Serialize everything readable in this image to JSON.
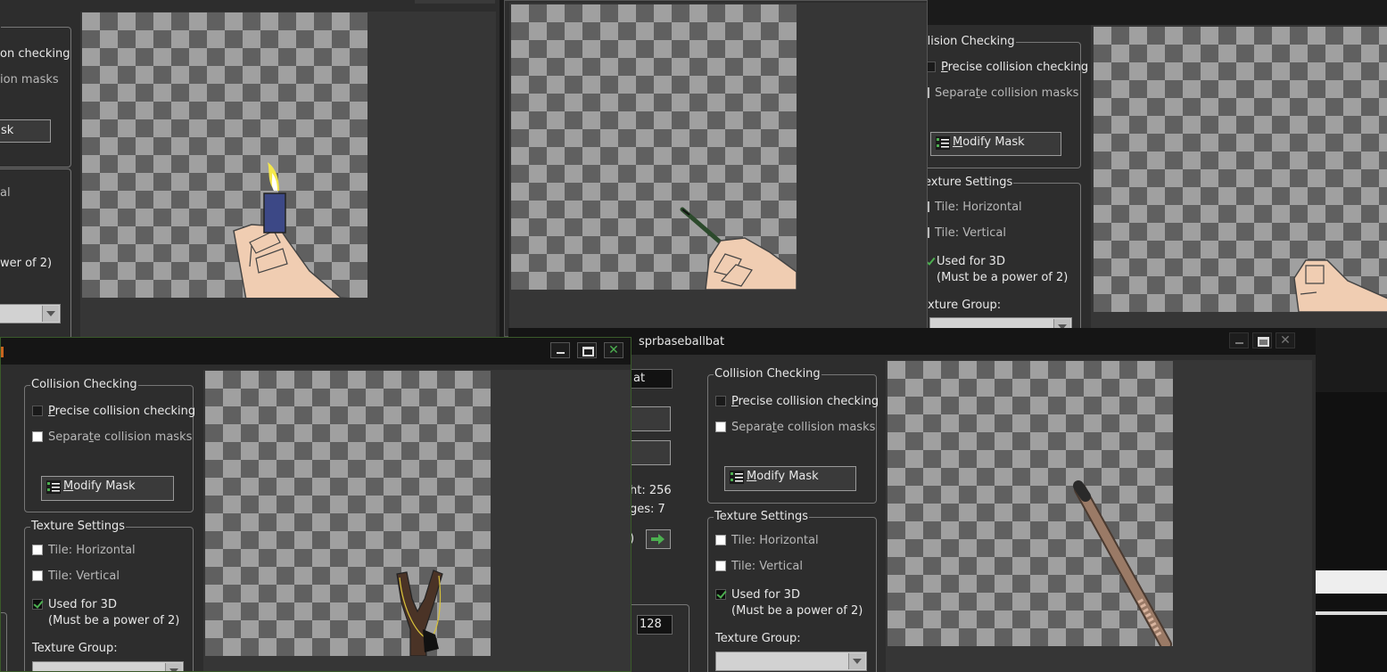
{
  "labels": {
    "collision_checking": "Collision Checking",
    "collision_checking_partial": "llision Checking",
    "precise_prefix": "P",
    "precise_rest": "recise collision checking",
    "precise_partial": "on checking",
    "separate_a": "Separa",
    "separate_u": "t",
    "separate_b": "e collision masks",
    "separate_partial": "ion masks",
    "modify_prefix": "M",
    "modify_rest": "odify Mask",
    "modify_partial": "sk",
    "texture_settings": "Texture Settings",
    "texture_settings_partial": "exture Settings",
    "tile_horizontal": "Tile: Horizontal",
    "tile_vertical": "Tile: Vertical",
    "used_for_3d": "Used for 3D",
    "power_of_2": "(Must be a power of 2)",
    "power_partial": "wer of 2)",
    "tal_partial": "al",
    "texture_group": "Texture Group:",
    "texture_group_partial": "xture Group:"
  },
  "window_baseballbat": {
    "title": "sprbaseballbat",
    "name_partial": "at",
    "height_partial": "ht: 256",
    "images_partial": "ges: 7",
    "paren_partial": ")",
    "origin_value": "128"
  },
  "colors": {
    "accent_green": "#4caf50",
    "checker_light": "#a0a0a0",
    "checker_dark": "#606060"
  },
  "icons": [
    "mask-icon",
    "arrow-right-icon",
    "minimize-icon",
    "maximize-icon",
    "close-icon",
    "lighter-hand-sprite",
    "pencil-hand-sprite",
    "fist-sprite",
    "slingshot-sprite",
    "baseball-bat-sprite"
  ]
}
